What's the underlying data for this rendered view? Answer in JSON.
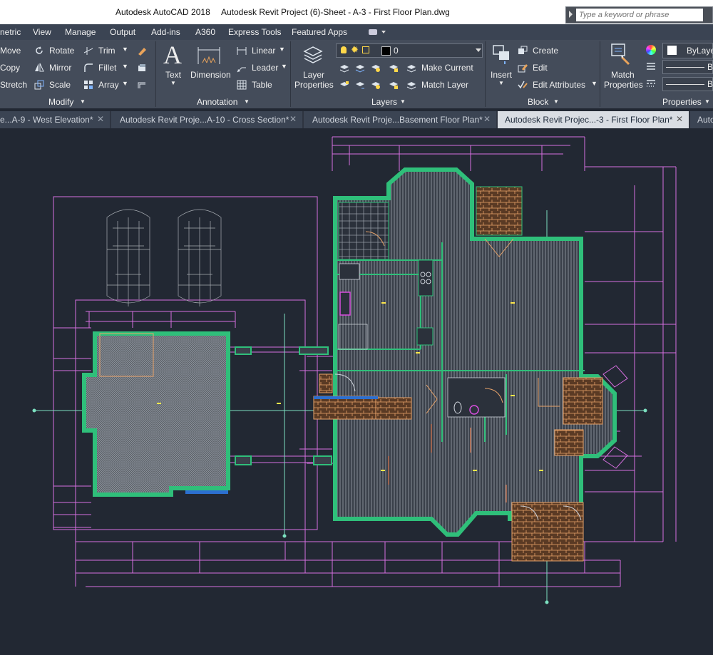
{
  "titlebar": {
    "app": "Autodesk AutoCAD 2018",
    "document": "Autodesk Revit Project  (6)-Sheet - A-3 - First Floor Plan.dwg",
    "search_placeholder": "Type a keyword or phrase"
  },
  "menu": [
    "netric",
    "View",
    "Manage",
    "Output",
    "Add-ins",
    "A360",
    "Express Tools",
    "Featured Apps"
  ],
  "modify": {
    "move": "Move",
    "copy": "Copy",
    "stretch": "Stretch",
    "rotate": "Rotate",
    "mirror": "Mirror",
    "scale": "Scale",
    "trim": "Trim",
    "fillet": "Fillet",
    "array": "Array",
    "label": "Modify"
  },
  "annotation": {
    "text": "Text",
    "dimension": "Dimension",
    "linear": "Linear",
    "leader": "Leader",
    "table": "Table",
    "label": "Annotation"
  },
  "layers": {
    "layer_properties_1": "Layer",
    "layer_properties_2": "Properties",
    "current_layer": "0",
    "make_current": "Make Current",
    "match_layer": "Match Layer",
    "label": "Layers"
  },
  "block": {
    "insert": "Insert",
    "create": "Create",
    "edit": "Edit",
    "edit_attributes": "Edit Attributes",
    "label": "Block"
  },
  "properties": {
    "match_1": "Match",
    "match_2": "Properties",
    "bylayer": "ByLayer",
    "b1": "B",
    "b2": "B",
    "label": "Properties"
  },
  "tabs": [
    {
      "label": "e...A-9 - West Elevation*"
    },
    {
      "label": "Autodesk Revit Proje...A-10 - Cross Section*"
    },
    {
      "label": "Autodesk Revit Proje...Basement Floor Plan*"
    },
    {
      "label": "Autodesk Revit Projec...-3 - First Floor Plan*"
    },
    {
      "label": "Auto"
    }
  ],
  "colors": {
    "canvas": "#222833",
    "wall": "#2fbf7a",
    "dimension": "#d76fe0",
    "floor": "#8e959e",
    "wood": "#e9a46a",
    "grid": "#7ce0c0"
  }
}
